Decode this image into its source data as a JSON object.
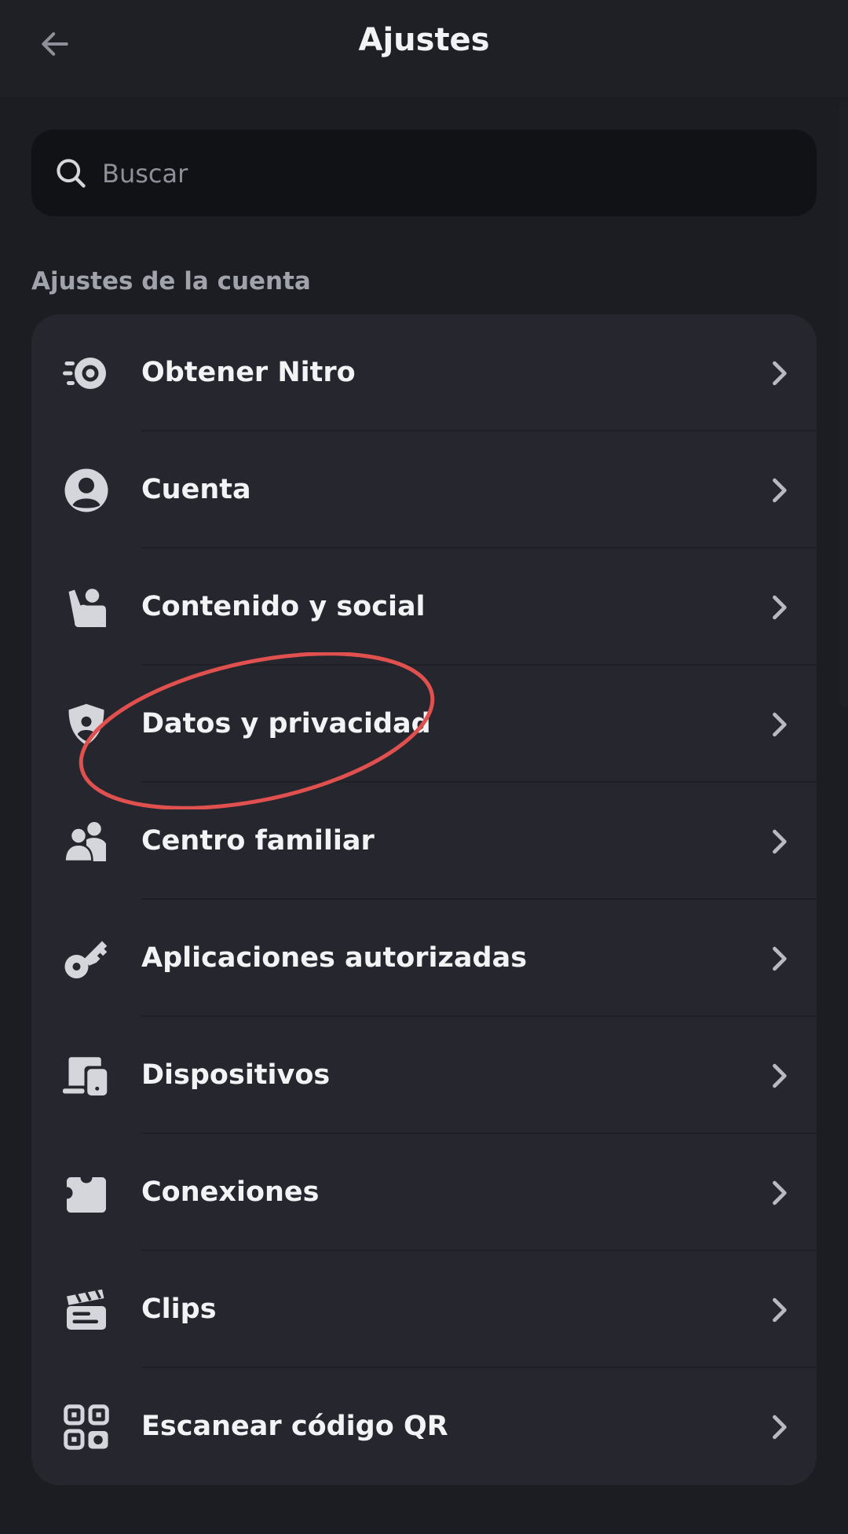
{
  "header": {
    "title": "Ajustes",
    "back_icon": "arrow-left-icon"
  },
  "search": {
    "placeholder": "Buscar",
    "value": "",
    "icon": "search-icon"
  },
  "section": {
    "label": "Ajustes de la cuenta"
  },
  "items": [
    {
      "label": "Obtener Nitro",
      "icon": "nitro-icon"
    },
    {
      "label": "Cuenta",
      "icon": "account-icon"
    },
    {
      "label": "Contenido y social",
      "icon": "waving-person-icon"
    },
    {
      "label": "Datos y privacidad",
      "icon": "shield-icon"
    },
    {
      "label": "Centro familiar",
      "icon": "family-icon"
    },
    {
      "label": "Aplicaciones autorizadas",
      "icon": "key-icon"
    },
    {
      "label": "Dispositivos",
      "icon": "devices-icon"
    },
    {
      "label": "Conexiones",
      "icon": "puzzle-icon"
    },
    {
      "label": "Clips",
      "icon": "clapperboard-icon"
    },
    {
      "label": "Escanear código QR",
      "icon": "qr-code-icon"
    }
  ],
  "annotation": {
    "color": "#e0504e",
    "target": "Datos y privacidad"
  },
  "colors": {
    "background": "#1c1d22",
    "card": "#26272e",
    "search": "#111215",
    "text": "#f2f3f5",
    "muted": "#a0a3ab"
  }
}
